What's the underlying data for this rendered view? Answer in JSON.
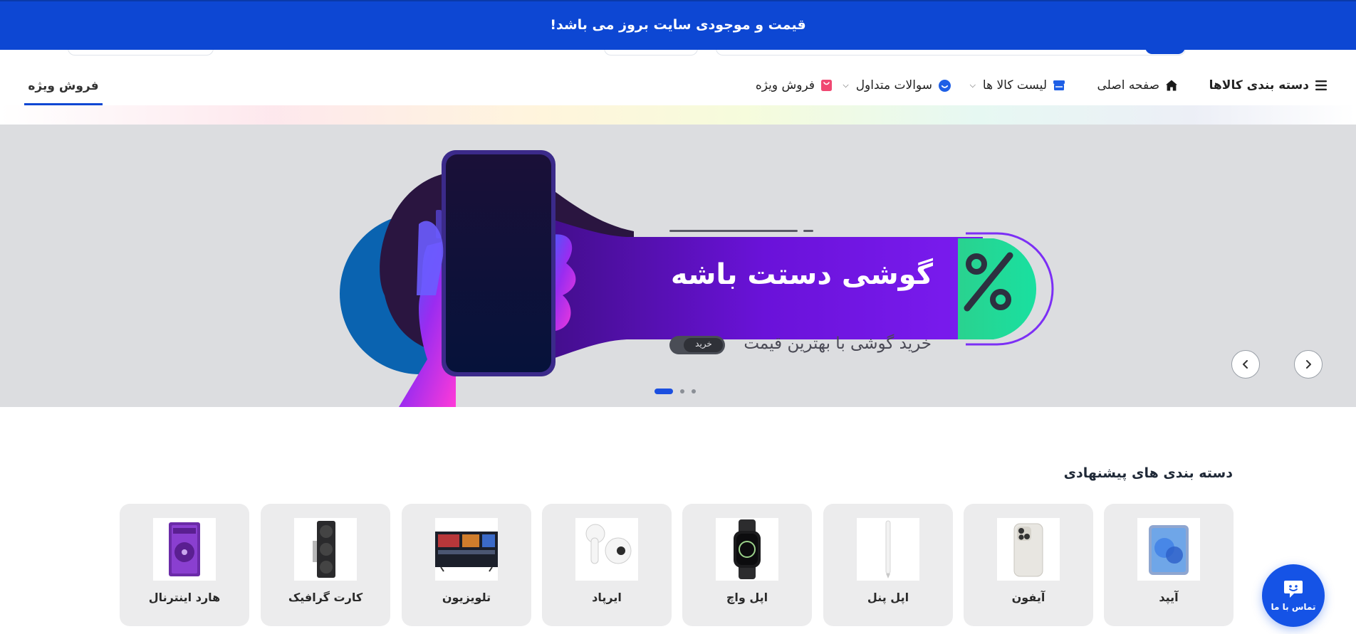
{
  "announcement": {
    "text": "قیمت و موجودی سایت بروز می باشد!"
  },
  "nav": {
    "categories_label": "دسته بندی کالاها",
    "items": [
      {
        "label": "صفحه اصلی",
        "icon": "home-icon"
      },
      {
        "label": "لیست کالا ها",
        "icon": "store-icon",
        "has_dropdown": true
      },
      {
        "label": "سوالات متداول",
        "icon": "faq-icon",
        "has_dropdown": true
      },
      {
        "label": "فروش ویژه",
        "icon": "gift-icon"
      }
    ],
    "special_tab": "فروش ویژه"
  },
  "hero": {
    "headline": "گوشی دستت باشه",
    "subline": "خرید گوشی با بهترین قیمت",
    "cta": "خرید",
    "badge_symbol": "%",
    "slides_count": 3,
    "active_slide": 1,
    "colors": {
      "purple": "#6a12d9",
      "green": "#21d693",
      "blue": "#0a63b0"
    }
  },
  "categories": {
    "title": "دسته بندی های پیشنهادی",
    "items": [
      {
        "name": "آیپد",
        "icon": "ipad-image"
      },
      {
        "name": "آیفون",
        "icon": "iphone-image"
      },
      {
        "name": "اپل پنل",
        "icon": "apple-pencil-image"
      },
      {
        "name": "اپل واچ",
        "icon": "apple-watch-image"
      },
      {
        "name": "ایرپاد",
        "icon": "airpods-image"
      },
      {
        "name": "تلویزیون",
        "icon": "tv-image"
      },
      {
        "name": "کارت گرافیک",
        "icon": "graphics-card-image"
      },
      {
        "name": "هارد اینترنال",
        "icon": "hard-drive-image"
      }
    ]
  },
  "contact": {
    "label": "تماس با ما"
  },
  "theme": {
    "primary": "#0d47d3",
    "card_bg": "#ececed"
  }
}
